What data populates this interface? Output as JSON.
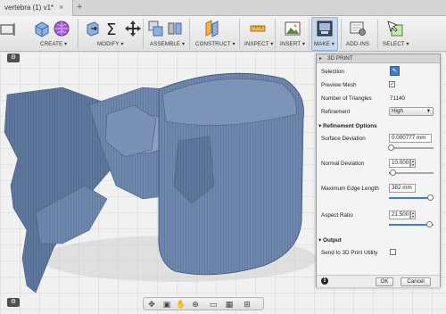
{
  "document": {
    "tab_title": "vertebra (1) v1*",
    "close_glyph": "×",
    "add_glyph": "+"
  },
  "toolbar": {
    "groups": [
      {
        "id": "create",
        "label": "CREATE ▾"
      },
      {
        "id": "modify",
        "label": "MODIFY ▾"
      },
      {
        "id": "assemble",
        "label": "ASSEMBLE ▾"
      },
      {
        "id": "construct",
        "label": "CONSTRUCT ▾"
      },
      {
        "id": "inspect",
        "label": "INSPECT ▾"
      },
      {
        "id": "insert",
        "label": "INSERT ▾"
      },
      {
        "id": "make",
        "label": "MAKE ▾"
      },
      {
        "id": "addins",
        "label": "ADD-INS"
      },
      {
        "id": "select",
        "label": "SELECT ▾"
      }
    ],
    "active_group": "make"
  },
  "panel": {
    "title": "3D PRINT",
    "collapse_glyph": "▸",
    "rows": {
      "selection_label": "Selection",
      "preview_mesh_label": "Preview Mesh",
      "preview_mesh_checked": true,
      "triangles_label": "Number of Triangles",
      "triangles_value": "71140",
      "refinement_label": "Refinement",
      "refinement_value": "High"
    },
    "refinement_options": {
      "header": "▾ Refinement Options",
      "surface_deviation_label": "Surface Deviation",
      "surface_deviation_value": "0.000777 mm",
      "surface_deviation_level": 0.05,
      "normal_deviation_label": "Normal Deviation",
      "normal_deviation_value": "10.000",
      "normal_deviation_level": 0.08,
      "max_edge_length_label": "Maximum Edge Length",
      "max_edge_length_value": "382 mm",
      "max_edge_length_level": 0.92,
      "aspect_ratio_label": "Aspect Ratio",
      "aspect_ratio_value": "21.500",
      "aspect_ratio_level": 0.9
    },
    "output": {
      "header": "▾ Output",
      "send_label": "Send to 3D Print Utility",
      "send_checked": false
    },
    "buttons": {
      "ok": "OK",
      "cancel": "Cancel"
    },
    "info_glyph": "i"
  },
  "viewport": {
    "gear_glyph": "⚙",
    "model_color": "#6f88ad",
    "nav_icons": [
      "orbit-icon",
      "pan-icon",
      "hand-icon",
      "zoom-icon",
      "display-icon",
      "grid-icon",
      "viewports-icon"
    ]
  }
}
